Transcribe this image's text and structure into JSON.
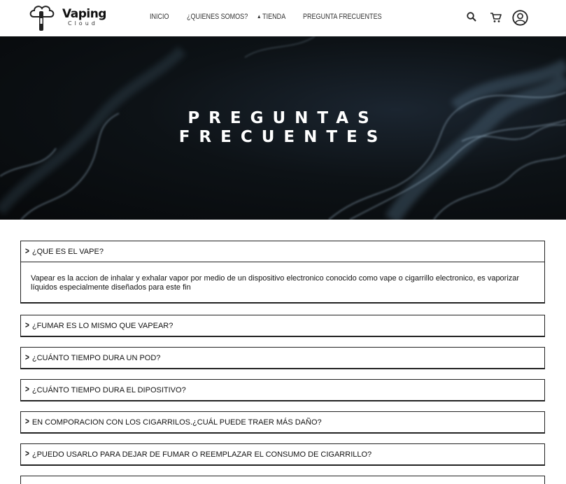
{
  "brand": {
    "name": "Vaping",
    "tagline": "Cloud"
  },
  "nav": {
    "items": [
      {
        "label": "INICIO"
      },
      {
        "label": "¿QUIENES SOMOS?"
      },
      {
        "label": "TIENDA"
      },
      {
        "label": "PREGUNTA FRECUENTES"
      }
    ]
  },
  "icons": {
    "search": "search-icon",
    "cart": "cart-icon",
    "account": "user-circle-icon"
  },
  "hero": {
    "title_line1": "PREGUNTAS",
    "title_line2": "FRECUENTES"
  },
  "faq": {
    "items": [
      {
        "question": "¿QUE ES EL VAPE?",
        "answer": "Vapear es la accion de inhalar y exhalar vapor por medio de un dispositivo electronico conocido como vape o cigarrillo electronico, es vaporizar líquidos especialmente diseñados para este fin",
        "expanded": true
      },
      {
        "question": "¿FUMAR ES LO MISMO QUE VAPEAR?"
      },
      {
        "question": "¿CUÁNTO TIEMPO DURA UN POD?"
      },
      {
        "question": "¿CUÁNTO TIEMPO DURA EL DIPOSITIVO?"
      },
      {
        "question": "EN COMPORACION CON LOS CIGARRILOS.¿CUÁL PUEDE TRAER MÁS DAÑO?"
      },
      {
        "question": "¿PUEDO USARLO PARA DEJAR DE FUMAR O REEMPLAZAR EL CONSUMO DE CIGARRILLO?"
      },
      {
        "question": ""
      }
    ]
  }
}
